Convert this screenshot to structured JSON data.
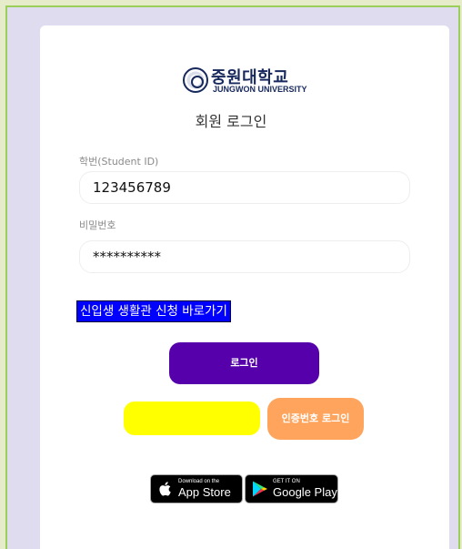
{
  "brand": {
    "name_kr": "중원대학교",
    "name_en": "JUNGWON UNIVERSITY",
    "color": "#17285c"
  },
  "page": {
    "title": "회원 로그인"
  },
  "form": {
    "student_id_label": "학번(Student ID)",
    "student_id_value": "123456789",
    "password_label": "비밀번호",
    "password_value": "**********"
  },
  "links": {
    "dorm_application": "신입생 생활관 신청 바로가기"
  },
  "buttons": {
    "login": "로그인",
    "auth_code_login": "인증번호 로그인",
    "yellow_button_label": ""
  },
  "stores": {
    "apple_small": "Download on the",
    "apple_big": "App Store",
    "google_small": "GET IT ON",
    "google_big": "Google Play"
  },
  "colors": {
    "login_button": "#5500aa",
    "auth_button": "#ffa45c",
    "yellow_button": "#ffff00",
    "dorm_link_bg": "#0000ff"
  }
}
